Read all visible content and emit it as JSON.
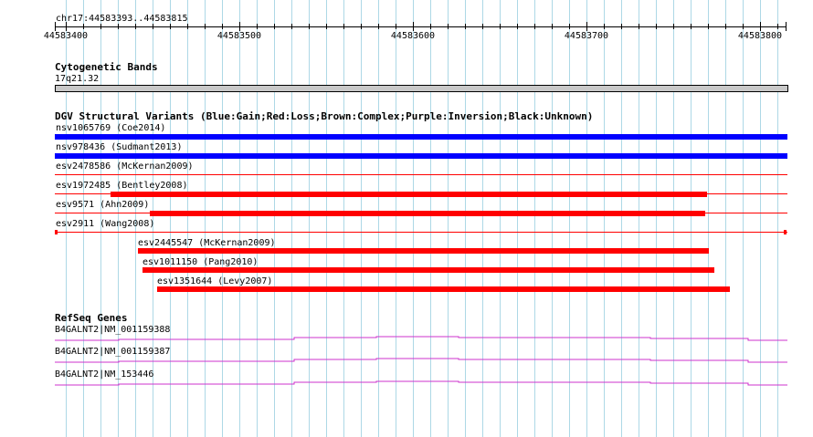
{
  "region": {
    "label": "chr17:44583393..44583815",
    "ticks": [
      "44583400",
      "44583500",
      "44583600",
      "44583700",
      "44583800"
    ]
  },
  "cyto": {
    "title": "Cytogenetic Bands",
    "band": "17q21.32"
  },
  "dgv": {
    "title": "DGV Structural Variants (Blue:Gain;Red:Loss;Brown:Complex;Purple:Inversion;Black:Unknown)",
    "features": [
      {
        "label": "nsv1065769 (Coe2014)",
        "type": "gain"
      },
      {
        "label": "nsv978436 (Sudmant2013)",
        "type": "gain"
      },
      {
        "label": "esv2478586 (McKernan2009)",
        "type": "loss"
      },
      {
        "label": "esv1972485 (Bentley2008)",
        "type": "loss"
      },
      {
        "label": "esv9571 (Ahn2009)",
        "type": "loss"
      },
      {
        "label": "esv2911 (Wang2008)",
        "type": "loss"
      },
      {
        "label": "esv2445547 (McKernan2009)",
        "type": "loss"
      },
      {
        "label": "esv1011150 (Pang2010)",
        "type": "loss"
      },
      {
        "label": "esv1351644 (Levy2007)",
        "type": "loss"
      }
    ]
  },
  "refseq": {
    "title": "RefSeq Genes",
    "genes": [
      {
        "label": "B4GALNT2|NM_001159388"
      },
      {
        "label": "B4GALNT2|NM_001159387"
      },
      {
        "label": "B4GALNT2|NM_153446"
      }
    ]
  },
  "colors": {
    "gain": "#0000ff",
    "loss": "#ff0000",
    "gene": "#cc33cc",
    "grid": "#add8e6"
  }
}
